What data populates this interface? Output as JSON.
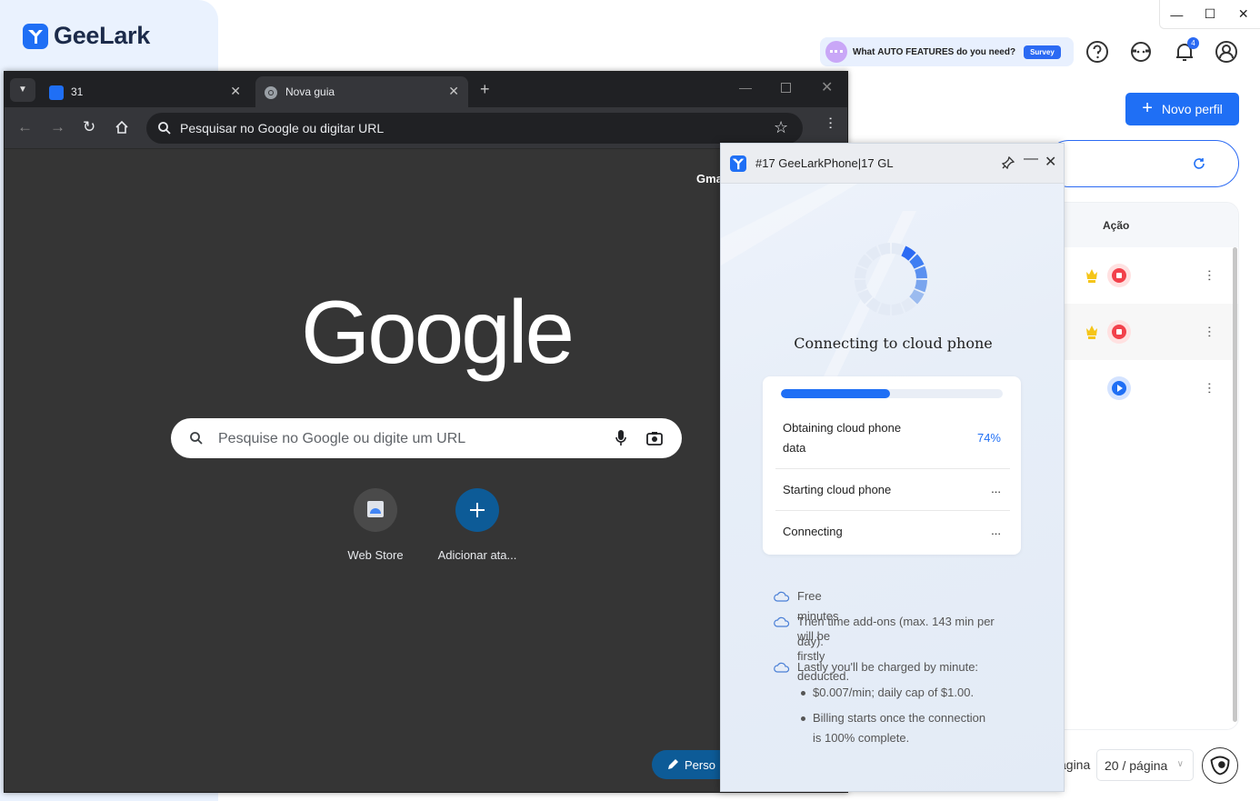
{
  "geelark": {
    "logo_text": "GeeLark",
    "survey_prompt_pre": "What ",
    "survey_prompt_bold": "AUTO FEATURES",
    "survey_prompt_post": " do you need?",
    "survey_button": "Survey",
    "notification_count": "4",
    "new_profile_label": "Novo perfil",
    "table_action_header": "Ação",
    "pager_label": "ágina",
    "page_size": "20 / página"
  },
  "chrome": {
    "tabs": [
      {
        "title": "31"
      },
      {
        "title": "Nova guia"
      }
    ],
    "omnibox_text": "Pesquisar no Google ou digitar URL",
    "gmail_link": "Gma",
    "google_logo": "Google",
    "search_placeholder": "Pesquise no Google ou digite um URL",
    "shortcuts": [
      {
        "label": "Web Store"
      },
      {
        "label": "Adicionar ata..."
      }
    ],
    "personalize_label": "Perso"
  },
  "dialog": {
    "title": "#17 GeeLarkPhone|17 GL",
    "heading": "Connecting to cloud phone",
    "progress_fraction": 0.49,
    "steps": [
      {
        "label_line1": "Obtaining cloud phone",
        "label_line2": "data",
        "value": "74%"
      },
      {
        "label_line1": "Starting cloud phone",
        "value": "..."
      },
      {
        "label_line1": "Connecting",
        "value": "..."
      }
    ],
    "notes": [
      {
        "line1": "Free minutes will be firstly deducted."
      },
      {
        "line1": "Then time add-ons (max. 143 min per",
        "line2": "day)."
      },
      {
        "line1": "Lastly you'll be charged by minute:"
      }
    ],
    "bullets": [
      {
        "line1": "$0.007/min; daily cap of $1.00."
      },
      {
        "line1": "Billing starts once the connection",
        "line2": "is 100% complete."
      }
    ]
  },
  "colors": {
    "accent": "#1f6ff5",
    "stop_red": "#f2414b",
    "chrome_bg": "#353535"
  }
}
